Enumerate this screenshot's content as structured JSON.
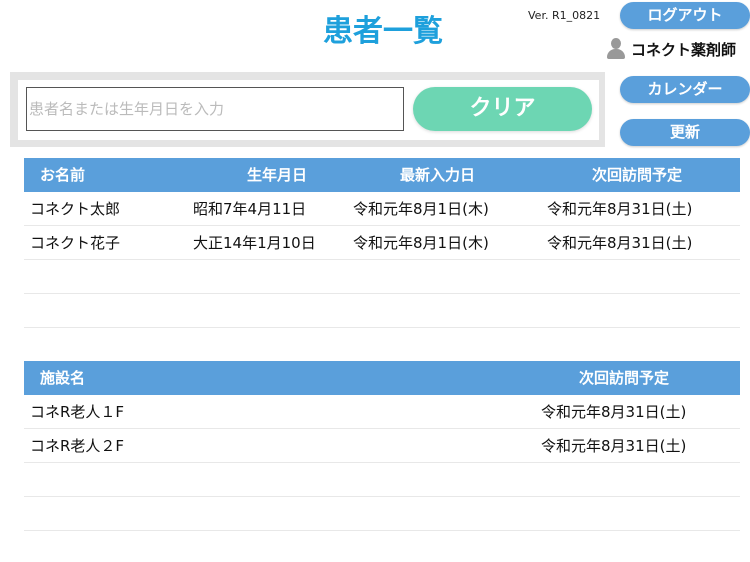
{
  "header": {
    "title": "患者一覧",
    "version": "Ver. R1_0821",
    "user": "コネクト薬剤師"
  },
  "buttons": {
    "logout": "ログアウト",
    "calendar": "カレンダー",
    "refresh": "更新",
    "clear": "クリア"
  },
  "search": {
    "placeholder": "患者名または生年月日を入力",
    "value": ""
  },
  "patients": {
    "columns": [
      "お名前",
      "生年月日",
      "最新入力日",
      "次回訪問予定"
    ],
    "rows": [
      [
        "コネクト太郎",
        "昭和7年4月11日",
        "令和元年8月1日(木)",
        "令和元年8月31日(土)"
      ],
      [
        "コネクト花子",
        "大正14年1月10日",
        "令和元年8月1日(木)",
        "令和元年8月31日(土)"
      ]
    ]
  },
  "facilities": {
    "columns": [
      "施設名",
      "次回訪問予定"
    ],
    "rows": [
      [
        "コネR老人１F",
        "令和元年8月31日(土)"
      ],
      [
        "コネR老人２F",
        "令和元年8月31日(土)"
      ]
    ]
  }
}
